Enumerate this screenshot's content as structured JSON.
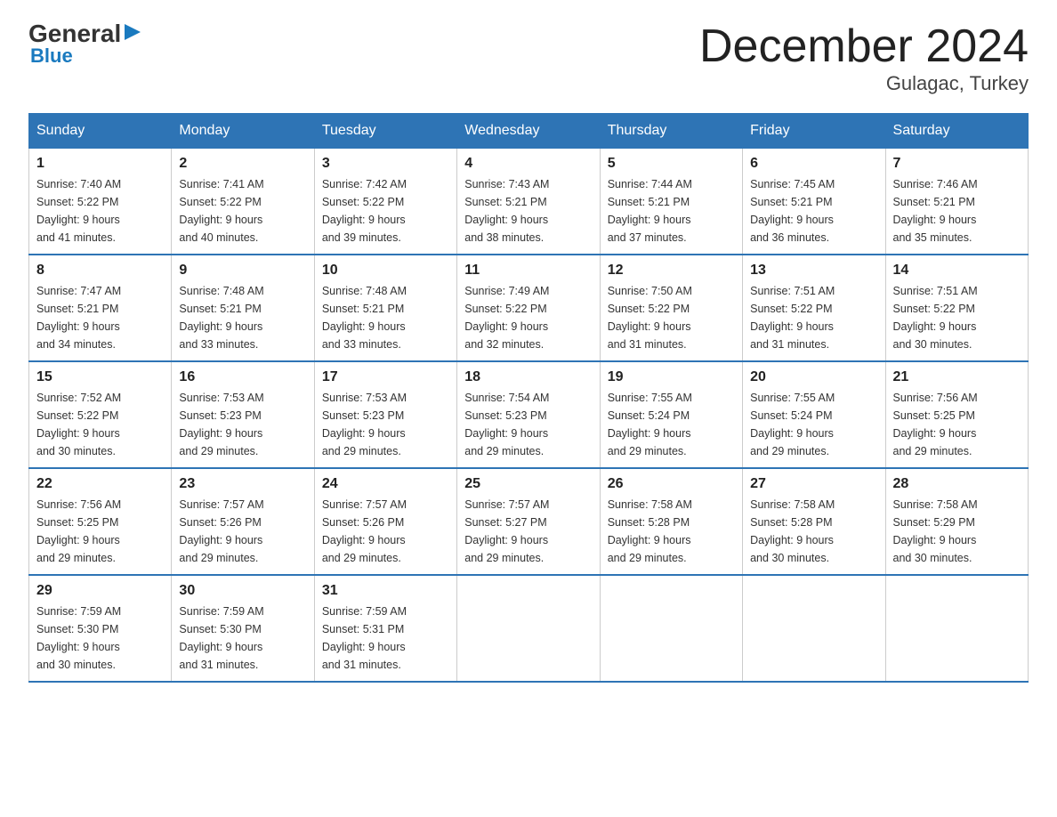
{
  "logo": {
    "general": "General",
    "blue": "Blue",
    "triangle": "▶"
  },
  "title": "December 2024",
  "subtitle": "Gulagac, Turkey",
  "header_days": [
    "Sunday",
    "Monday",
    "Tuesday",
    "Wednesday",
    "Thursday",
    "Friday",
    "Saturday"
  ],
  "weeks": [
    [
      {
        "day": "1",
        "sunrise": "7:40 AM",
        "sunset": "5:22 PM",
        "daylight": "9 hours and 41 minutes."
      },
      {
        "day": "2",
        "sunrise": "7:41 AM",
        "sunset": "5:22 PM",
        "daylight": "9 hours and 40 minutes."
      },
      {
        "day": "3",
        "sunrise": "7:42 AM",
        "sunset": "5:22 PM",
        "daylight": "9 hours and 39 minutes."
      },
      {
        "day": "4",
        "sunrise": "7:43 AM",
        "sunset": "5:21 PM",
        "daylight": "9 hours and 38 minutes."
      },
      {
        "day": "5",
        "sunrise": "7:44 AM",
        "sunset": "5:21 PM",
        "daylight": "9 hours and 37 minutes."
      },
      {
        "day": "6",
        "sunrise": "7:45 AM",
        "sunset": "5:21 PM",
        "daylight": "9 hours and 36 minutes."
      },
      {
        "day": "7",
        "sunrise": "7:46 AM",
        "sunset": "5:21 PM",
        "daylight": "9 hours and 35 minutes."
      }
    ],
    [
      {
        "day": "8",
        "sunrise": "7:47 AM",
        "sunset": "5:21 PM",
        "daylight": "9 hours and 34 minutes."
      },
      {
        "day": "9",
        "sunrise": "7:48 AM",
        "sunset": "5:21 PM",
        "daylight": "9 hours and 33 minutes."
      },
      {
        "day": "10",
        "sunrise": "7:48 AM",
        "sunset": "5:21 PM",
        "daylight": "9 hours and 33 minutes."
      },
      {
        "day": "11",
        "sunrise": "7:49 AM",
        "sunset": "5:22 PM",
        "daylight": "9 hours and 32 minutes."
      },
      {
        "day": "12",
        "sunrise": "7:50 AM",
        "sunset": "5:22 PM",
        "daylight": "9 hours and 31 minutes."
      },
      {
        "day": "13",
        "sunrise": "7:51 AM",
        "sunset": "5:22 PM",
        "daylight": "9 hours and 31 minutes."
      },
      {
        "day": "14",
        "sunrise": "7:51 AM",
        "sunset": "5:22 PM",
        "daylight": "9 hours and 30 minutes."
      }
    ],
    [
      {
        "day": "15",
        "sunrise": "7:52 AM",
        "sunset": "5:22 PM",
        "daylight": "9 hours and 30 minutes."
      },
      {
        "day": "16",
        "sunrise": "7:53 AM",
        "sunset": "5:23 PM",
        "daylight": "9 hours and 29 minutes."
      },
      {
        "day": "17",
        "sunrise": "7:53 AM",
        "sunset": "5:23 PM",
        "daylight": "9 hours and 29 minutes."
      },
      {
        "day": "18",
        "sunrise": "7:54 AM",
        "sunset": "5:23 PM",
        "daylight": "9 hours and 29 minutes."
      },
      {
        "day": "19",
        "sunrise": "7:55 AM",
        "sunset": "5:24 PM",
        "daylight": "9 hours and 29 minutes."
      },
      {
        "day": "20",
        "sunrise": "7:55 AM",
        "sunset": "5:24 PM",
        "daylight": "9 hours and 29 minutes."
      },
      {
        "day": "21",
        "sunrise": "7:56 AM",
        "sunset": "5:25 PM",
        "daylight": "9 hours and 29 minutes."
      }
    ],
    [
      {
        "day": "22",
        "sunrise": "7:56 AM",
        "sunset": "5:25 PM",
        "daylight": "9 hours and 29 minutes."
      },
      {
        "day": "23",
        "sunrise": "7:57 AM",
        "sunset": "5:26 PM",
        "daylight": "9 hours and 29 minutes."
      },
      {
        "day": "24",
        "sunrise": "7:57 AM",
        "sunset": "5:26 PM",
        "daylight": "9 hours and 29 minutes."
      },
      {
        "day": "25",
        "sunrise": "7:57 AM",
        "sunset": "5:27 PM",
        "daylight": "9 hours and 29 minutes."
      },
      {
        "day": "26",
        "sunrise": "7:58 AM",
        "sunset": "5:28 PM",
        "daylight": "9 hours and 29 minutes."
      },
      {
        "day": "27",
        "sunrise": "7:58 AM",
        "sunset": "5:28 PM",
        "daylight": "9 hours and 30 minutes."
      },
      {
        "day": "28",
        "sunrise": "7:58 AM",
        "sunset": "5:29 PM",
        "daylight": "9 hours and 30 minutes."
      }
    ],
    [
      {
        "day": "29",
        "sunrise": "7:59 AM",
        "sunset": "5:30 PM",
        "daylight": "9 hours and 30 minutes."
      },
      {
        "day": "30",
        "sunrise": "7:59 AM",
        "sunset": "5:30 PM",
        "daylight": "9 hours and 31 minutes."
      },
      {
        "day": "31",
        "sunrise": "7:59 AM",
        "sunset": "5:31 PM",
        "daylight": "9 hours and 31 minutes."
      },
      null,
      null,
      null,
      null
    ]
  ],
  "sunrise_label": "Sunrise:",
  "sunset_label": "Sunset:",
  "daylight_label": "Daylight:"
}
